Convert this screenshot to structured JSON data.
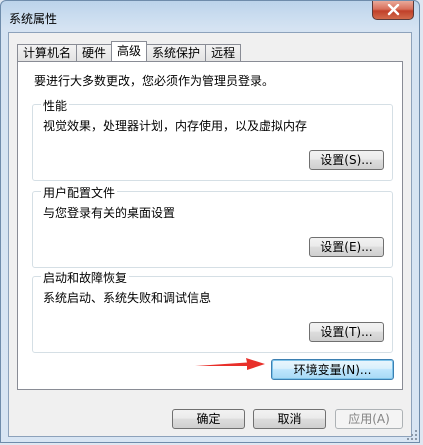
{
  "window": {
    "title": "系统属性"
  },
  "tabs": [
    {
      "label": "计算机名",
      "active": false
    },
    {
      "label": "硬件",
      "active": false
    },
    {
      "label": "高级",
      "active": true
    },
    {
      "label": "系统保护",
      "active": false
    },
    {
      "label": "远程",
      "active": false
    }
  ],
  "advanced": {
    "notice": "要进行大多数更改，您必须作为管理员登录。",
    "performance": {
      "title": "性能",
      "description": "视觉效果，处理器计划，内存使用，以及虚拟内存",
      "button": "设置(S)..."
    },
    "user_profiles": {
      "title": "用户配置文件",
      "description": "与您登录有关的桌面设置",
      "button": "设置(E)..."
    },
    "startup_recovery": {
      "title": "启动和故障恢复",
      "description": "系统启动、系统失败和调试信息",
      "button": "设置(T)..."
    },
    "env_button": "环境变量(N)..."
  },
  "footer": {
    "ok": "确定",
    "cancel": "取消",
    "apply": "应用(A)"
  },
  "colors": {
    "arrow": "#e8302a",
    "close_button": "#c94a34"
  }
}
